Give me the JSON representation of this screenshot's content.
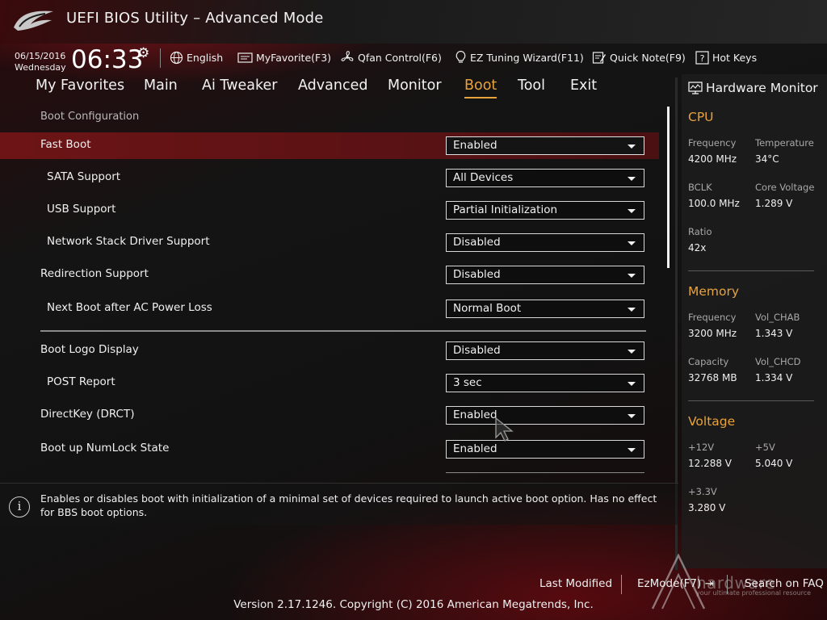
{
  "window": {
    "title": "UEFI BIOS Utility – Advanced Mode"
  },
  "toolbar": {
    "date": "06/15/2016",
    "weekday": "Wednesday",
    "time": "06:33",
    "items": [
      {
        "label": "English",
        "icon": "globe-icon"
      },
      {
        "label": "MyFavorite(F3)",
        "icon": "favorites-icon"
      },
      {
        "label": "Qfan Control(F6)",
        "icon": "fan-icon"
      },
      {
        "label": "EZ Tuning Wizard(F11)",
        "icon": "lightbulb-icon"
      },
      {
        "label": "Quick Note(F9)",
        "icon": "note-icon"
      },
      {
        "label": "Hot Keys",
        "icon": "question-icon"
      }
    ]
  },
  "tabs": [
    {
      "label": "My Favorites",
      "active": false
    },
    {
      "label": "Main",
      "active": false
    },
    {
      "label": "Ai Tweaker",
      "active": false
    },
    {
      "label": "Advanced",
      "active": false
    },
    {
      "label": "Monitor",
      "active": false
    },
    {
      "label": "Boot",
      "active": true
    },
    {
      "label": "Tool",
      "active": false
    },
    {
      "label": "Exit",
      "active": false
    }
  ],
  "main": {
    "section": "Boot Configuration",
    "rows": [
      {
        "label": "Fast Boot",
        "value": "Enabled",
        "selected": true
      },
      {
        "label": "SATA Support",
        "value": "All Devices"
      },
      {
        "label": "USB Support",
        "value": "Partial Initialization"
      },
      {
        "label": "Network Stack Driver Support",
        "value": "Disabled"
      },
      {
        "label": "Redirection Support",
        "value": "Disabled"
      },
      {
        "label": "Next Boot after AC Power Loss",
        "value": "Normal Boot"
      },
      {
        "label": "Boot Logo Display",
        "value": "Disabled"
      },
      {
        "label": "POST Report",
        "value": "3 sec"
      },
      {
        "label": "DirectKey (DRCT)",
        "value": "Enabled"
      },
      {
        "label": "Boot up NumLock State",
        "value": "Enabled"
      }
    ]
  },
  "help": {
    "text": "Enables or disables boot with initialization of a minimal set of devices required to launch active boot option. Has no effect for BBS boot options."
  },
  "footer": {
    "last_modified": "Last Modified",
    "ezmode": "EzMode(F7)",
    "search_faq": "Search on FAQ",
    "version": "Version 2.17.1246. Copyright (C) 2016 American Megatrends, Inc."
  },
  "watermark": {
    "text": "hardware",
    "sub": "your ultimate professional resource"
  },
  "hardware_monitor": {
    "title": "Hardware Monitor",
    "cpu": {
      "title": "CPU",
      "frequency_label": "Frequency",
      "frequency": "4200 MHz",
      "temperature_label": "Temperature",
      "temperature": "34°C",
      "bclk_label": "BCLK",
      "bclk": "100.0 MHz",
      "core_voltage_label": "Core Voltage",
      "core_voltage": "1.289 V",
      "ratio_label": "Ratio",
      "ratio": "42x"
    },
    "memory": {
      "title": "Memory",
      "frequency_label": "Frequency",
      "frequency": "3200 MHz",
      "vol_chab_label": "Vol_CHAB",
      "vol_chab": "1.343 V",
      "capacity_label": "Capacity",
      "capacity": "32768 MB",
      "vol_chcd_label": "Vol_CHCD",
      "vol_chcd": "1.334 V"
    },
    "voltage": {
      "title": "Voltage",
      "v12_label": "+12V",
      "v12": "12.288 V",
      "v5_label": "+5V",
      "v5": "5.040 V",
      "v33_label": "+3.3V",
      "v33": "3.280 V"
    }
  },
  "colors": {
    "accent": "#e8a23c",
    "highlight": "#6d1416",
    "brand_red": "#be141e"
  }
}
